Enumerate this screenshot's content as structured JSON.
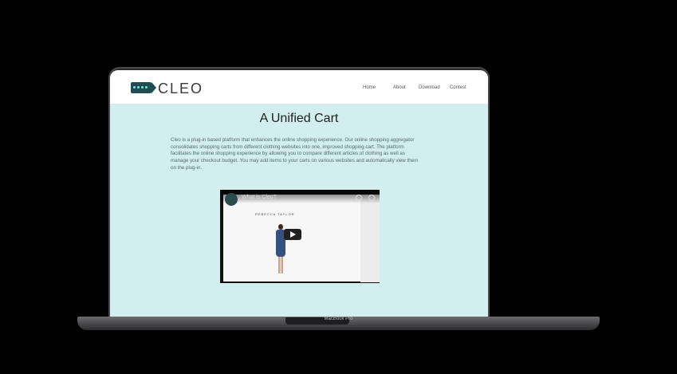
{
  "site": {
    "logo_text": "CLEO",
    "nav": [
      "Home",
      "About",
      "Download",
      "Contest"
    ],
    "title": "A Unified Cart",
    "description": "Cleo is a plug-in based platform that enhances the online shopping experience. Our online shopping aggregator consolidates shopping carts from different clothing websites into one, improved shopping cart. The platform facilitates the online shopping experience by allowing you to compare different articles of clothing as well as manage your checkout budget. You may add items to your carts on various websites and automatically view them on the plug-in."
  },
  "video": {
    "title": "What is Cleo?",
    "storefront": "REBECCA TAYLOR"
  },
  "device": {
    "label": "MacBook Pro"
  },
  "colors": {
    "page_bg": "#d2eeee",
    "nav_bg": "#ffffff",
    "accent": "#1f4d52"
  }
}
